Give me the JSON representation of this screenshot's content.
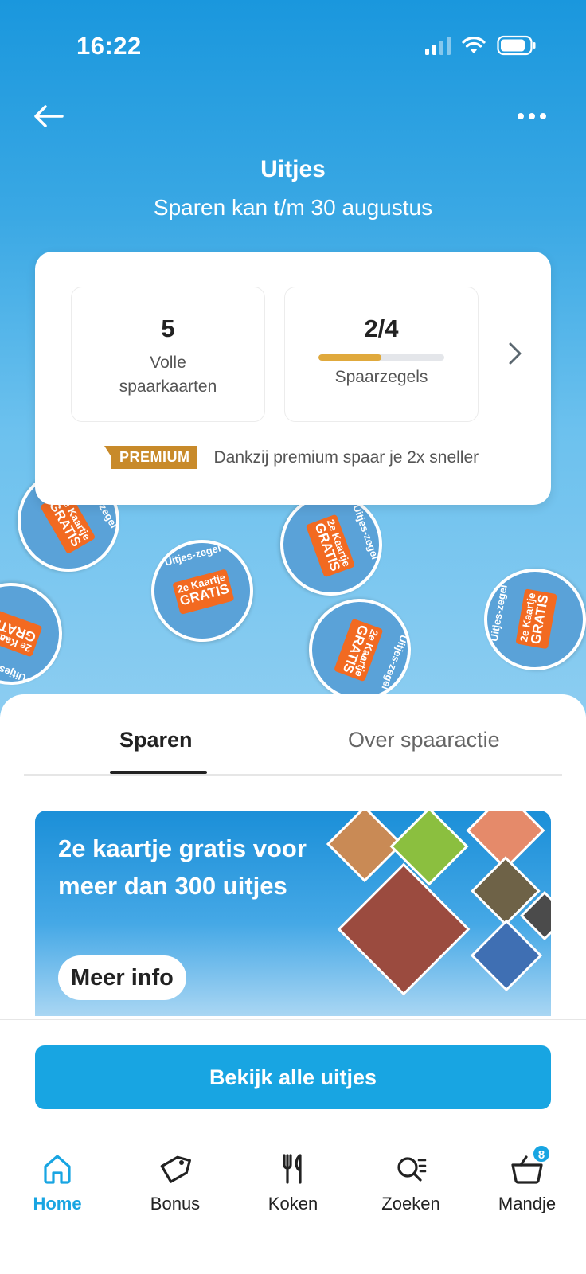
{
  "status_bar": {
    "time": "16:22"
  },
  "header": {
    "title": "Uitjes",
    "subtitle": "Sparen kan t/m 30 augustus"
  },
  "savings_card": {
    "full_cards": {
      "value": "5",
      "label_line1": "Volle",
      "label_line2": "spaarkaarten"
    },
    "stamps": {
      "value": "2/4",
      "label": "Spaarzegels",
      "progress_fraction": 0.5
    },
    "premium_badge": "PREMIUM",
    "premium_text": "Dankzij premium spaar je 2x sneller"
  },
  "stamps_decor": {
    "ring_text": "Uitjes-zegel",
    "ticket_line1": "2e Kaartje",
    "ticket_line2": "GRATIS"
  },
  "tabs": [
    {
      "label": "Sparen",
      "active": true
    },
    {
      "label": "Over spaaractie",
      "active": false
    }
  ],
  "promo": {
    "text": "2e kaartje gratis voor meer dan 300 uitjes",
    "button_label": "Meer info"
  },
  "cta": {
    "label": "Bekijk alle uitjes"
  },
  "tabbar": {
    "items": [
      {
        "label": "Home",
        "icon": "home-icon",
        "active": true
      },
      {
        "label": "Bonus",
        "icon": "tag-icon",
        "active": false
      },
      {
        "label": "Koken",
        "icon": "cutlery-icon",
        "active": false
      },
      {
        "label": "Zoeken",
        "icon": "search-icon",
        "active": false
      },
      {
        "label": "Mandje",
        "icon": "basket-icon",
        "active": false,
        "badge": "8"
      }
    ]
  },
  "colors": {
    "brand_blue": "#18a5e2",
    "premium_gold": "#c88a2a",
    "stamp_orange": "#f26a21"
  }
}
